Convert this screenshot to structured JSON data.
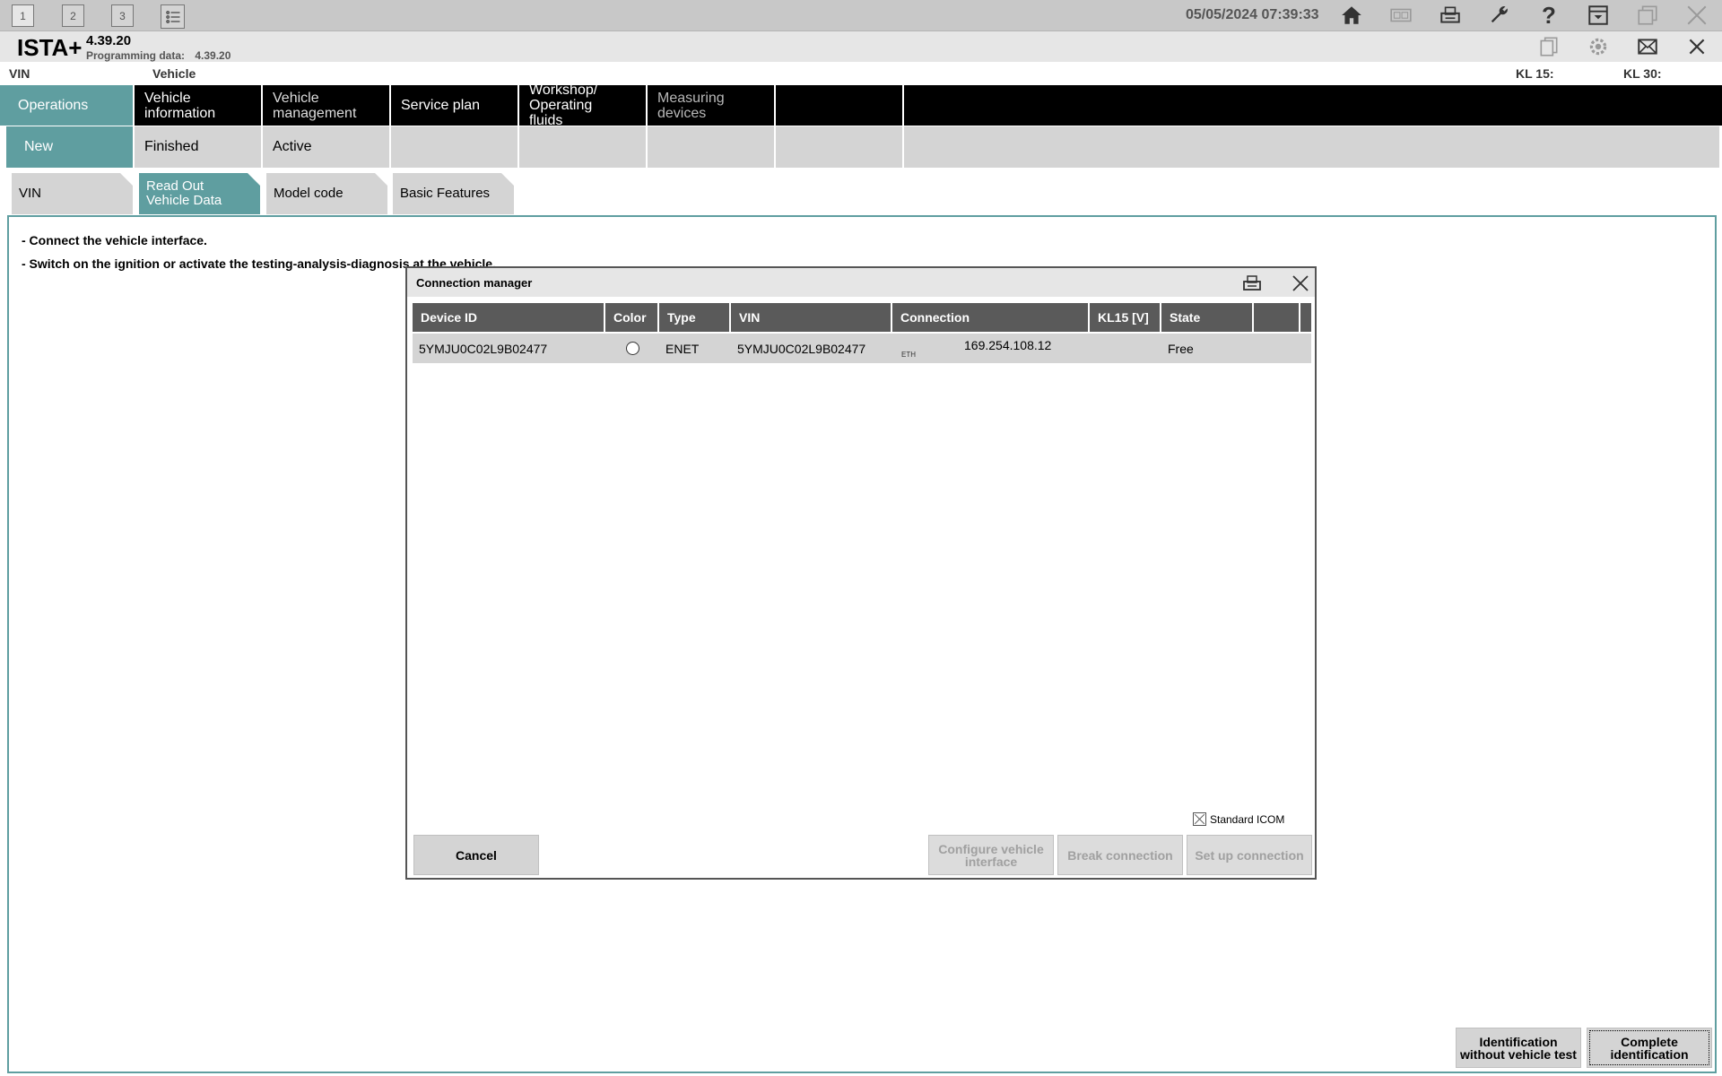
{
  "sessions": [
    "1",
    "2",
    "3"
  ],
  "datetime": "05/05/2024 07:39:33",
  "header": {
    "brand": "ISTA+",
    "version": "4.39.20",
    "programming_label": "Programming data:",
    "programming_version": "4.39.20"
  },
  "infoline": {
    "vin_label": "VIN",
    "vehicle_label": "Vehicle",
    "kl15": "KL 15:",
    "kl30": "KL 30:"
  },
  "nav": [
    "Operations",
    "Vehicle information",
    "Vehicle management",
    "Service plan",
    "Workshop/ Operating fluids",
    "Measuring devices"
  ],
  "subnav": [
    "New",
    "Finished",
    "Active"
  ],
  "tabs": [
    "VIN",
    "Read Out Vehicle Data",
    "Model code",
    "Basic Features"
  ],
  "instructions": [
    "- Connect the vehicle interface.",
    "- Switch on the ignition or activate the testing-analysis-diagnosis at the vehicle."
  ],
  "dialog": {
    "title": "Connection manager",
    "columns": [
      "Device ID",
      "Color",
      "Type",
      "VIN",
      "Connection",
      "KL15 [V]",
      "State"
    ],
    "row": {
      "device_id": "5YMJU0C02L9B02477",
      "type": "ENET",
      "vin": "5YMJU0C02L9B02477",
      "conn_type": "ETH",
      "ip": "169.254.108.12",
      "kl15": "",
      "state": "Free"
    },
    "standard_icom": "Standard ICOM",
    "buttons": {
      "cancel": "Cancel",
      "configure": "Configure vehicle interface",
      "break": "Break connection",
      "setup": "Set up connection"
    }
  },
  "bottom_buttons": {
    "without_test": "Identification without vehicle test",
    "complete": "Complete identification"
  }
}
